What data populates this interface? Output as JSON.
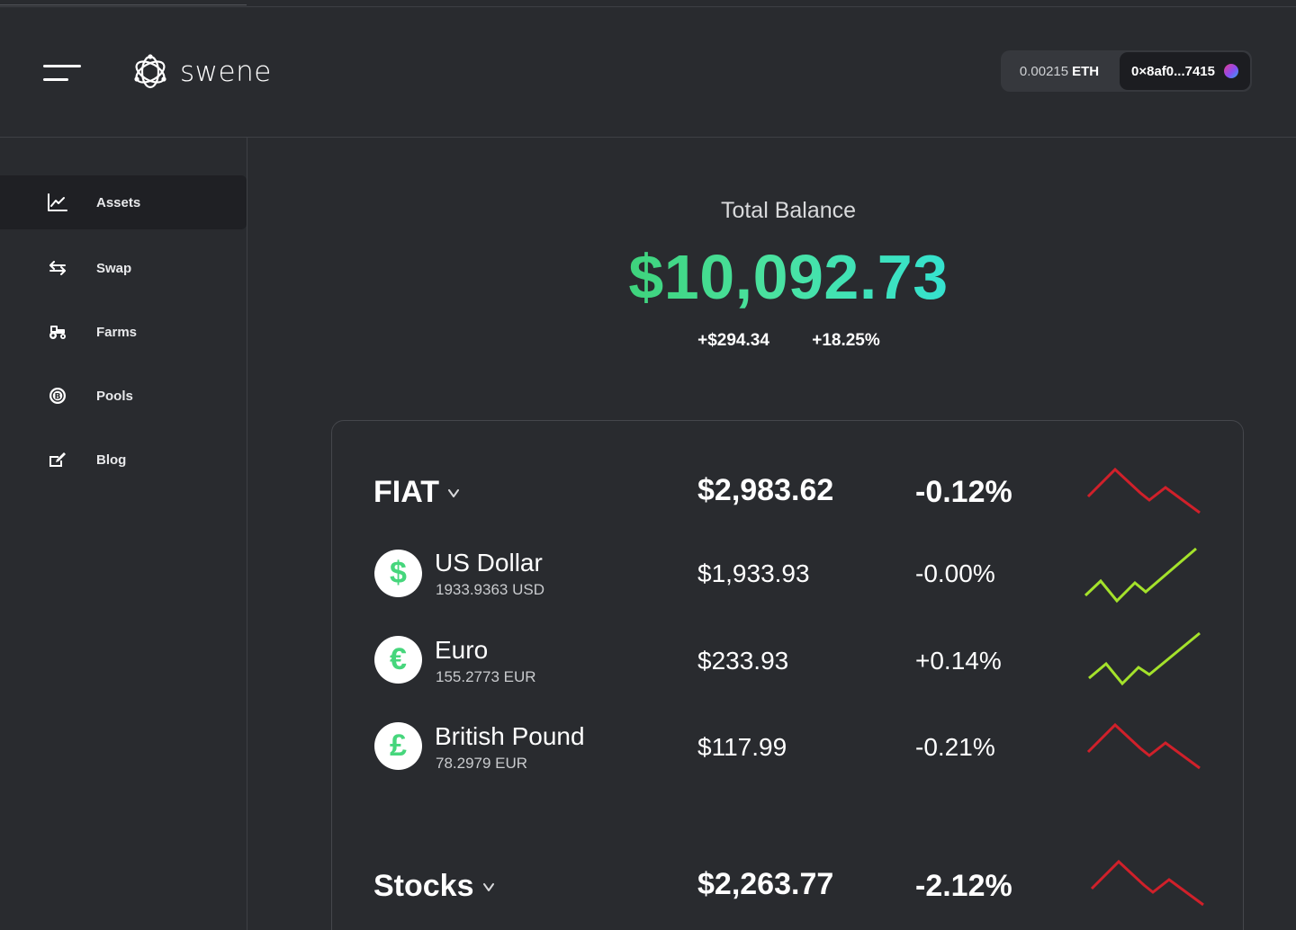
{
  "app": {
    "name": "swene"
  },
  "wallet": {
    "balance_amount": "0.00215",
    "balance_unit": "ETH",
    "address": "0×8af0...7415"
  },
  "sidebar": {
    "items": [
      {
        "label": "Assets",
        "icon": "chart-line-icon",
        "active": true
      },
      {
        "label": "Swap",
        "icon": "swap-arrows-icon",
        "active": false
      },
      {
        "label": "Farms",
        "icon": "tractor-icon",
        "active": false
      },
      {
        "label": "Pools",
        "icon": "coin-pool-icon",
        "active": false
      },
      {
        "label": "Blog",
        "icon": "blog-pen-icon",
        "active": false
      }
    ]
  },
  "balance": {
    "title": "Total Balance",
    "value": "$10,092.73",
    "change_abs": "+$294.34",
    "change_pct": "+18.25%"
  },
  "groups": [
    {
      "title": "FIAT",
      "value": "$2,983.62",
      "change": "-0.12%",
      "trend": "down",
      "assets": [
        {
          "symbol": "$",
          "name": "US Dollar",
          "amount": "1933.9363 USD",
          "value": "$1,933.93",
          "change": "-0.00%",
          "trend": "up"
        },
        {
          "symbol": "€",
          "name": "Euro",
          "amount": "155.2773 EUR",
          "value": "$233.93",
          "change": "+0.14%",
          "trend": "up"
        },
        {
          "symbol": "£",
          "name": "British Pound",
          "amount": "78.2979 EUR",
          "value": "$117.99",
          "change": "-0.21%",
          "trend": "down"
        }
      ]
    },
    {
      "title": "Stocks",
      "value": "$2,263.77",
      "change": "-2.12%",
      "trend": "down",
      "assets": []
    }
  ],
  "colors": {
    "background": "#292b2f",
    "sidebar_active": "#1f2024",
    "balance_gradient_start": "#3ed37c",
    "balance_gradient_end": "#35e2d0",
    "trend_up": "#a4e22b",
    "trend_down": "#d0202a",
    "coin_glyph": "#46d67c"
  }
}
